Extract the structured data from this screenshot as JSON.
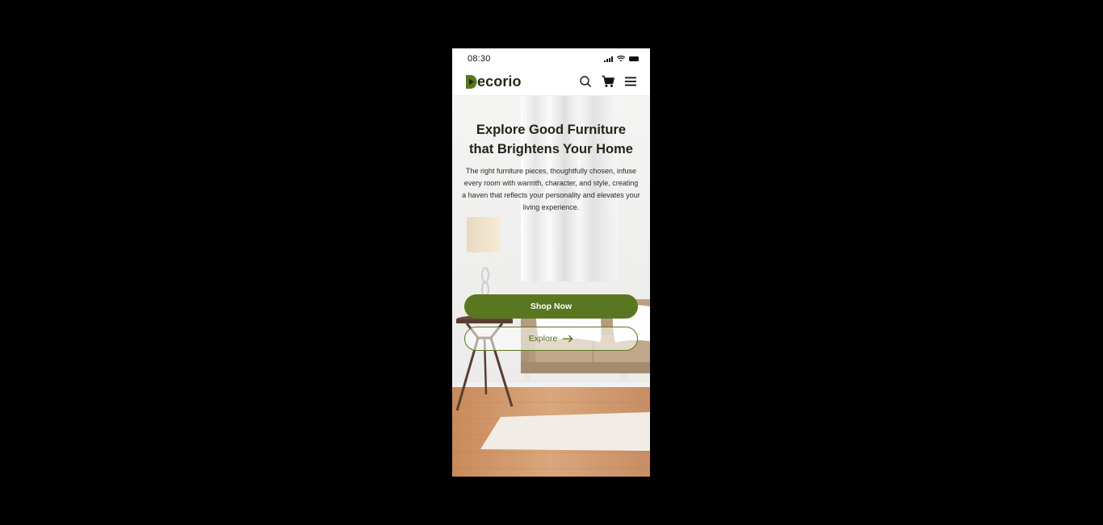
{
  "status_bar": {
    "time": "08:30"
  },
  "header": {
    "logo_text": "ecorio",
    "logo_letter": "D"
  },
  "hero": {
    "title_line1": "Explore Good Furniture",
    "title_line2": "that Brightens Your Home",
    "description": "The right furniture pieces, thoughtfully chosen, infuse every room with warmth, character, and style, creating a haven that reflects your personality and elevates your living experience.",
    "shop_button_label": "Shop Now",
    "explore_button_label": "Explore"
  },
  "colors": {
    "brand": "#597720",
    "title": "#1e2614"
  }
}
